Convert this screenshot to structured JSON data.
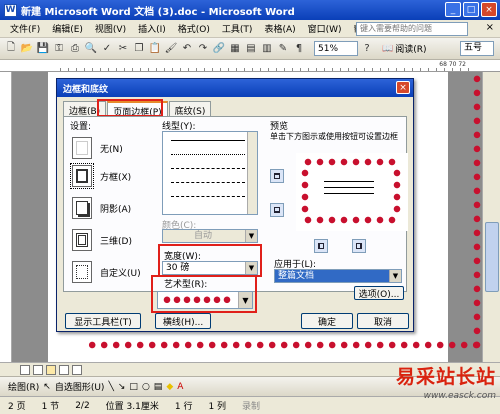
{
  "window": {
    "title": "新建 Microsoft Word 文档 (3).doc - Microsoft Word",
    "app_icon": "W"
  },
  "menu": {
    "items": [
      "文件(F)",
      "编辑(E)",
      "视图(V)",
      "插入(I)",
      "格式(O)",
      "工具(T)",
      "表格(A)",
      "窗口(W)",
      "帮助(H)"
    ],
    "help_placeholder": "键入需要帮助的问题",
    "close": "×"
  },
  "toolbar": {
    "zoom": "51%",
    "read_label": "阅读(R)",
    "font_size": "五号"
  },
  "ruler": {
    "right_marks": "68 70 72"
  },
  "dialog": {
    "title": "边框和底纹",
    "tabs": [
      "边框(B)",
      "页面边框(P)",
      "底纹(S)"
    ],
    "active_tab": 1,
    "setting_label": "设置:",
    "settings": [
      "无(N)",
      "方框(X)",
      "阴影(A)",
      "三维(D)",
      "自定义(U)"
    ],
    "style_label": "线型(Y):",
    "color_label": "颜色(C):",
    "color_value": "自动",
    "width_label": "宽度(W):",
    "width_value": "30 磅",
    "art_label": "艺术型(R):",
    "preview_label": "预览",
    "preview_hint": "单击下方图示或使用按钮可设置边框",
    "apply_label": "应用于(L):",
    "apply_value": "整篇文档",
    "options_button": "选项(O)...",
    "show_toolbar_button": "显示工具栏(T)",
    "hline_button": "横线(H)...",
    "ok_button": "确定",
    "cancel_button": "取消"
  },
  "drawbar": {
    "draw_label": "绘图(R)",
    "autoshapes_label": "自选图形(U)"
  },
  "status": {
    "page": "2 页",
    "section": "1 节",
    "pages": "2/2",
    "position": "位置 3.1厘米",
    "line": "1 行",
    "col": "1 列",
    "rec": "录制"
  },
  "watermark": {
    "text": "易采站长站",
    "url": "www.easck.com"
  },
  "colors": {
    "title_bar": "#0a3fb8",
    "highlight_red": "#e0201a",
    "art_red": "#c8102e"
  }
}
